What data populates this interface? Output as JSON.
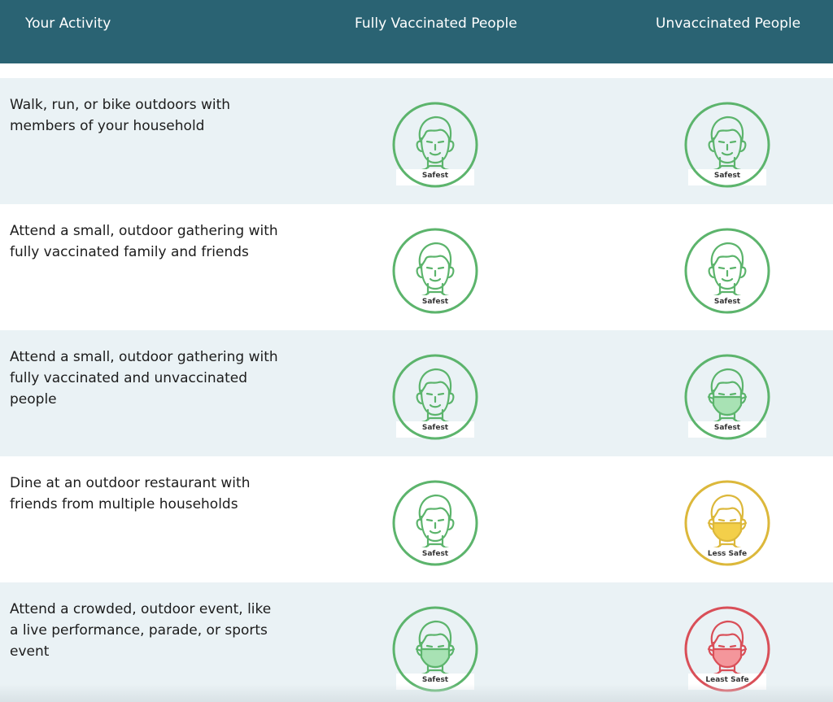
{
  "header": {
    "activity": "Your Activity",
    "vaccinated": "Fully Vaccinated People",
    "unvaccinated": "Unvaccinated People"
  },
  "colors": {
    "header_bg": "#2a6373",
    "safest": "#5cb46c",
    "safest_mask": "#a8e2b4",
    "less_safe": "#dcb83b",
    "less_safe_mask": "#f3cf4a",
    "least_safe": "#d94f58",
    "least_safe_mask": "#f4969b"
  },
  "rows": [
    {
      "activity": "Walk, run, or bike outdoors with members of your household",
      "vaccinated": {
        "label": "Safest",
        "level": "safest",
        "mask": false,
        "mask_color": "none"
      },
      "unvaccinated": {
        "label": "Safest",
        "level": "safest",
        "mask": false,
        "mask_color": "none"
      }
    },
    {
      "activity": "Attend a small, outdoor gathering with fully vaccinated family and friends",
      "vaccinated": {
        "label": "Safest",
        "level": "safest",
        "mask": false,
        "mask_color": "none"
      },
      "unvaccinated": {
        "label": "Safest",
        "level": "safest",
        "mask": false,
        "mask_color": "none"
      }
    },
    {
      "activity": "Attend a small, outdoor gathering with fully vaccinated and unvaccinated people",
      "vaccinated": {
        "label": "Safest",
        "level": "safest",
        "mask": false,
        "mask_color": "none"
      },
      "unvaccinated": {
        "label": "Safest",
        "level": "safest",
        "mask": true,
        "mask_color": "green"
      }
    },
    {
      "activity": "Dine at an outdoor restaurant with friends from multiple households",
      "vaccinated": {
        "label": "Safest",
        "level": "safest",
        "mask": false,
        "mask_color": "none"
      },
      "unvaccinated": {
        "label": "Less Safe",
        "level": "less_safe",
        "mask": true,
        "mask_color": "yellow"
      }
    },
    {
      "activity": "Attend a crowded, outdoor event, like a live performance, parade, or sports event",
      "vaccinated": {
        "label": "Safest",
        "level": "safest",
        "mask": true,
        "mask_color": "green"
      },
      "unvaccinated": {
        "label": "Least Safe",
        "level": "least_safe",
        "mask": true,
        "mask_color": "red"
      }
    }
  ]
}
